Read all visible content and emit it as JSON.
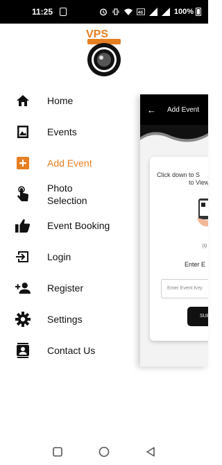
{
  "status_bar": {
    "time": "11:25",
    "battery": "100%",
    "icons": [
      "sim-card-icon",
      "alarm-icon",
      "vibrate-icon",
      "wifi-icon",
      "volte-icon",
      "signal-icon",
      "battery-icon"
    ]
  },
  "logo": {
    "text": "VPS",
    "accent_color": "#e67e22"
  },
  "menu": {
    "items": [
      {
        "label": "Home",
        "icon": "home-icon"
      },
      {
        "label": "Events",
        "icon": "image-icon"
      },
      {
        "label": "Add Event",
        "icon": "add-box-icon",
        "active": true
      },
      {
        "label": "Photo Selection",
        "icon": "touch-icon"
      },
      {
        "label": "Event Booking",
        "icon": "thumb-up-icon"
      },
      {
        "label": "Login",
        "icon": "login-icon"
      },
      {
        "label": "Register",
        "icon": "person-add-icon"
      },
      {
        "label": "Settings",
        "icon": "gear-icon"
      },
      {
        "label": "Contact Us",
        "icon": "contacts-icon"
      }
    ],
    "active_color": "#e67e22"
  },
  "background_screen": {
    "title": "Add Event",
    "instruction_line1": "Click down to S",
    "instruction_line2": "to View",
    "small_text": "[Q",
    "enter_label": "Enter E",
    "input_placeholder": "Enter Event Key",
    "submit_label": "SUB"
  },
  "nav_bar": {
    "buttons": [
      "recents-button",
      "home-button",
      "back-button"
    ]
  }
}
